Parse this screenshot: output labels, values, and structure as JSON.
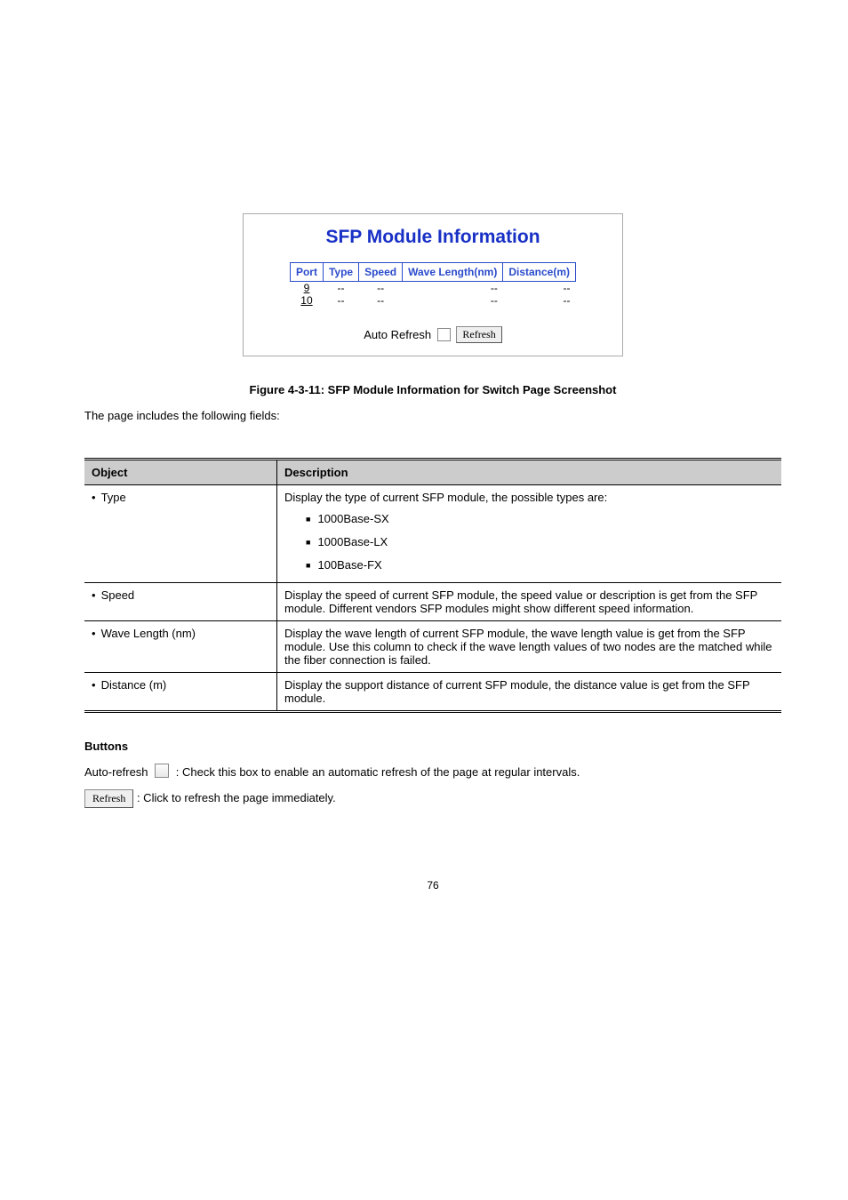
{
  "panel": {
    "title": "SFP Module Information",
    "headers": [
      "Port",
      "Type",
      "Speed",
      "Wave Length(nm)",
      "Distance(m)"
    ],
    "rows": [
      {
        "port": "9",
        "type": "--",
        "speed": "--",
        "wave": "--",
        "dist": "--"
      },
      {
        "port": "10",
        "type": "--",
        "speed": "--",
        "wave": "--",
        "dist": "--"
      }
    ],
    "auto_refresh_label": "Auto Refresh",
    "refresh_label": "Refresh"
  },
  "figure_caption": "Figure 4-3-11: SFP Module Information for Switch Page Screenshot",
  "page_note": "The page includes the following fields:",
  "desc_table": {
    "head": {
      "object": "Object",
      "description": "Description"
    },
    "rows": [
      {
        "object": "Type",
        "desc_lead": "Display the type of current SFP module, the possible types are:",
        "sub": [
          "1000Base-SX",
          "1000Base-LX",
          "100Base-FX"
        ]
      },
      {
        "object": "Speed",
        "desc_lead": "Display the speed of current SFP module, the speed value or description is get from the SFP module. Different vendors SFP modules might show different speed information."
      },
      {
        "object": "Wave Length (nm)",
        "desc_lead": "Display the wave length of current SFP module, the wave length value is get from the SFP module. Use this column to check if the wave length values of two nodes are the matched while the fiber connection is failed."
      },
      {
        "object": "Distance (m)",
        "desc_lead": "Display the support distance of current SFP module, the distance value is get from the SFP module."
      }
    ]
  },
  "buttons": {
    "heading": "Buttons",
    "auto_refresh_label": "Auto-refresh",
    "auto_refresh_desc": ": Check this box to enable an automatic refresh of the page at regular intervals.",
    "refresh_label": "Refresh",
    "refresh_desc": ": Click to refresh the page immediately."
  },
  "page_number": "76"
}
